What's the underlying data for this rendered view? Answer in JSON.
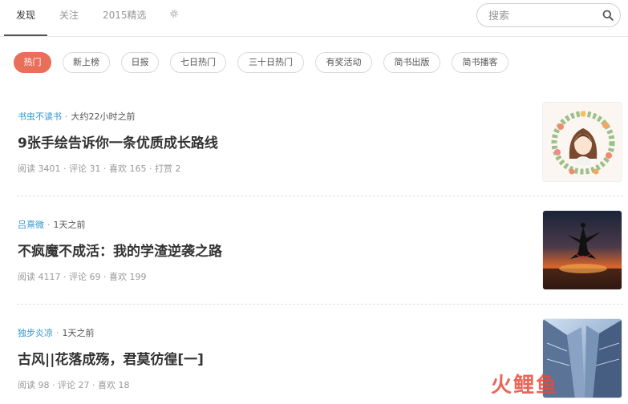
{
  "nav": {
    "tabs": [
      {
        "label": "发现"
      },
      {
        "label": "关注"
      },
      {
        "label": "2015精选"
      }
    ],
    "settings_icon": "gear-icon",
    "search": {
      "placeholder": "搜索",
      "icon": "search-icon"
    }
  },
  "categories": [
    "热门",
    "新上榜",
    "日报",
    "七日热门",
    "三十日热门",
    "有奖活动",
    "简书出版",
    "简书播客"
  ],
  "colors": {
    "accent": "#ea6f5a",
    "author_link": "#3194d0",
    "muted": "#999999"
  },
  "articles": [
    {
      "author": "书虫不读书",
      "time": "大约22小时之前",
      "title": "9张手绘告诉你一条优质成长路线",
      "stats": "阅读 3401 · 评论 31 · 喜欢 165 · 打赏 2",
      "thumb": "illustration of girl in floral wreath"
    },
    {
      "author": "吕熹微",
      "time": "1天之前",
      "title": "不疯魔不成活：我的学渣逆袭之路",
      "stats": "阅读 4117 · 评论 69 · 喜欢 199",
      "thumb": "silhouette of dancer jumping at sunset"
    },
    {
      "author": "独步炎凉",
      "time": "1天之前",
      "title": "古风||花落成殇，君莫彷徨[一]",
      "stats": "阅读 98 · 评论 27 · 喜欢 18",
      "thumb": "skyscrapers looking up at sky"
    }
  ],
  "watermark": "火鲤鱼"
}
